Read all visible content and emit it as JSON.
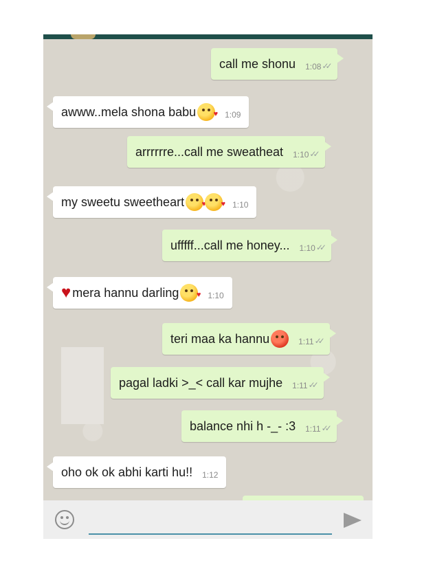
{
  "messages": [
    {
      "dir": "out",
      "text": "call me shonu",
      "time": "1:08",
      "ticks": "✓✓"
    },
    {
      "dir": "in",
      "text": "awww..mela shona babu",
      "time": "1:09",
      "emojis": [
        "kiss-heart-emoji"
      ]
    },
    {
      "dir": "out",
      "text": "arrrrrre...call me sweatheat",
      "time": "1:10",
      "ticks": "✓✓"
    },
    {
      "dir": "in",
      "text": "my sweetu sweetheart",
      "time": "1:10",
      "emojis": [
        "kiss-heart-emoji",
        "kiss-heart-emoji"
      ]
    },
    {
      "dir": "out",
      "text": "ufffff...call me honey...",
      "time": "1:10",
      "ticks": "✓✓"
    },
    {
      "dir": "in",
      "text": "mera hannu darling",
      "time": "1:10",
      "emojis": [
        "red-heart-emoji",
        "kiss-heart-emoji"
      ]
    },
    {
      "dir": "out",
      "text": "teri maa ka hannu",
      "time": "1:11",
      "ticks": "✓✓",
      "emojis": [
        "angry-face-emoji"
      ]
    },
    {
      "dir": "out",
      "text": "pagal ladki >_< call kar mujhe",
      "time": "1:11",
      "ticks": "✓✓"
    },
    {
      "dir": "out",
      "text": "balance nhi h -_- :3",
      "time": "1:11",
      "ticks": "✓✓"
    },
    {
      "dir": "in",
      "text": "oho ok ok abhi karti hu!!",
      "time": "1:12"
    }
  ],
  "input": {
    "placeholder": "",
    "value": ""
  },
  "icons": {
    "emoji_button": "smiley-icon",
    "send_button": "send-icon"
  },
  "colors": {
    "outgoing_bubble": "#e2f7cb",
    "incoming_bubble": "#ffffff",
    "wallpaper": "#d9d5cc"
  }
}
